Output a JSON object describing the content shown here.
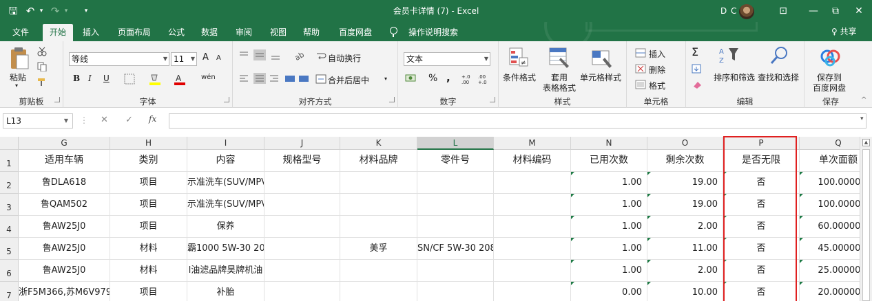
{
  "window": {
    "title": "会员卡详情 (7)  -  Excel",
    "user_initials": "D C",
    "controls": {
      "ribbon_display": "⊡",
      "minimize": "—",
      "restore": "⧉",
      "close": "✕"
    }
  },
  "quick_access": {
    "save": "🖫",
    "undo": "↶",
    "undo_dd": "▾",
    "redo": "↷",
    "redo_dd": "▾",
    "customize": "▾"
  },
  "tabs": [
    {
      "label": "文件",
      "active": false
    },
    {
      "label": "开始",
      "active": true
    },
    {
      "label": "插入",
      "active": false
    },
    {
      "label": "页面布局",
      "active": false
    },
    {
      "label": "公式",
      "active": false
    },
    {
      "label": "数据",
      "active": false
    },
    {
      "label": "审阅",
      "active": false
    },
    {
      "label": "视图",
      "active": false
    },
    {
      "label": "帮助",
      "active": false
    },
    {
      "label": "百度网盘",
      "active": false
    }
  ],
  "tell_me": "操作说明搜索",
  "share": "♀ 共享",
  "ribbon": {
    "clipboard": {
      "label": "剪贴板",
      "paste": "粘贴"
    },
    "font": {
      "label": "字体",
      "font_name": "等线",
      "font_size": "11",
      "grow": "A",
      "shrink": "A",
      "bold": "B",
      "italic": "I",
      "underline": "U",
      "pinyin": "wén"
    },
    "alignment": {
      "label": "对齐方式",
      "wrap": "自动换行",
      "merge": "合并后居中"
    },
    "number": {
      "label": "数字",
      "format": "文本",
      "percent": "%",
      "comma": ",",
      "inc": "+.0 .00",
      "dec": ".00 +.0"
    },
    "styles": {
      "label": "样式",
      "conditional": "条件格式",
      "table_line1": "套用",
      "table_line2": "表格格式",
      "cell_styles": "单元格样式"
    },
    "cells": {
      "label": "单元格",
      "insert": "插入",
      "delete": "删除",
      "format": "格式"
    },
    "editing": {
      "label": "编辑",
      "sort": "排序和筛选",
      "find": "查找和选择"
    },
    "save": {
      "label": "保存",
      "line1": "保存到",
      "line2": "百度网盘"
    }
  },
  "formula_bar": {
    "name_box": "L13",
    "cancel": "✕",
    "enter": "✓",
    "fx": "fx",
    "content": ""
  },
  "columns": [
    {
      "letter": "G",
      "header": "适用车辆",
      "selected": false
    },
    {
      "letter": "H",
      "header": "类别",
      "selected": false
    },
    {
      "letter": "I",
      "header": "内容",
      "selected": false
    },
    {
      "letter": "J",
      "header": "规格型号",
      "selected": false
    },
    {
      "letter": "K",
      "header": "材料品牌",
      "selected": false
    },
    {
      "letter": "L",
      "header": "零件号",
      "selected": true
    },
    {
      "letter": "M",
      "header": "材料编码",
      "selected": false
    },
    {
      "letter": "N",
      "header": "已用次数",
      "selected": false
    },
    {
      "letter": "O",
      "header": "剩余次数",
      "selected": false
    },
    {
      "letter": "P",
      "header": "是否无限",
      "selected": false
    },
    {
      "letter": "Q",
      "header": "单次面额",
      "selected": false
    }
  ],
  "rows": [
    {
      "num": "2",
      "cells": [
        "鲁DLA618",
        "项目",
        "示准洗车(SUV/MPV",
        "",
        "",
        "",
        "",
        "1.00",
        "19.00",
        "否",
        "100.000000"
      ]
    },
    {
      "num": "3",
      "cells": [
        "鲁QAM502",
        "项目",
        "示准洗车(SUV/MPV",
        "",
        "",
        "",
        "",
        "1.00",
        "19.00",
        "否",
        "100.000000"
      ]
    },
    {
      "num": "4",
      "cells": [
        "鲁AW25J0",
        "项目",
        "保养",
        "",
        "",
        "",
        "",
        "1.00",
        "2.00",
        "否",
        "60.0000000"
      ]
    },
    {
      "num": "5",
      "cells": [
        "鲁AW25J0",
        "材料",
        "霸1000 5W-30 20",
        "",
        "美孚",
        "SN/CF 5W-30 208l",
        "",
        "1.00",
        "11.00",
        "否",
        "45.0000000"
      ]
    },
    {
      "num": "6",
      "cells": [
        "鲁AW25J0",
        "材料",
        "l油滤品牌昊牌机油",
        "",
        "",
        "",
        "",
        "1.00",
        "2.00",
        "否",
        "25.0000000"
      ]
    },
    {
      "num": "7",
      "cells": [
        "浙F5M366,苏M6V979",
        "项目",
        "补胎",
        "",
        "",
        "",
        "",
        "0.00",
        "10.00",
        "否",
        "20.0000000"
      ]
    }
  ],
  "header_row_num": "1",
  "accent": "#217346",
  "highlight_color": "#e02020"
}
